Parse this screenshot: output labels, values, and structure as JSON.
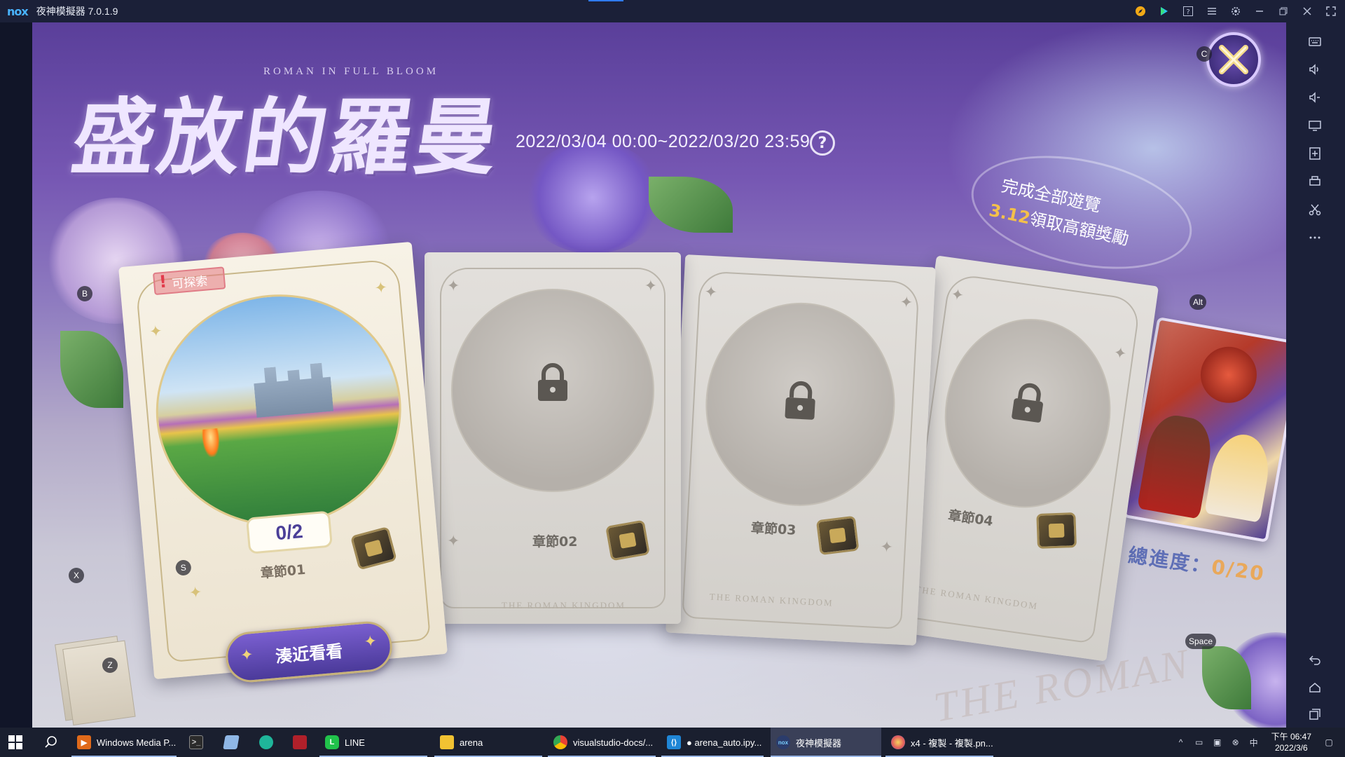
{
  "window": {
    "logo": "nox",
    "title": "夜神模擬器 7.0.1.9",
    "titlebar_icons": [
      "compass-icon",
      "play-store-icon",
      "help-icon",
      "menu-icon",
      "settings-icon",
      "minimize-icon",
      "restore-icon",
      "close-icon",
      "fullscreen-icon"
    ]
  },
  "sidebar": {
    "buttons": [
      "keyboard-icon",
      "volume-up-icon",
      "volume-down-icon",
      "screen-icon",
      "add-apk-icon",
      "printer-icon",
      "scissors-icon",
      "more-icon",
      "back-icon",
      "home-icon",
      "recent-apps-icon"
    ]
  },
  "game": {
    "event_title": "盛放的羅曼",
    "event_subtitle": "ROMAN IN FULL BLOOM",
    "date_range": "2022/03/04 00:00~2022/03/20 23:59",
    "help_symbol": "?",
    "reward_line1": "完成全部遊覽",
    "reward_date": "3.12",
    "reward_line2": "領取高額獎勵",
    "explore_badge": "可探索",
    "explore_mark": "!",
    "cards": [
      {
        "chapter": "章節01",
        "progress": "0/2",
        "kingdom": "",
        "locked": false
      },
      {
        "chapter": "章節02",
        "kingdom": "THE ROMAN KINGDOM",
        "locked": true
      },
      {
        "chapter": "章節03",
        "kingdom": "THE ROMAN KINGDOM",
        "locked": true
      },
      {
        "chapter": "章節04",
        "kingdom": "THE ROMAN KINGDOM",
        "locked": true
      }
    ],
    "approach_button": "湊近看看",
    "total_label": "總進度：",
    "total_value": "0/20",
    "watermark": "THE ROMAN KIN",
    "key_hints": {
      "close": "C",
      "card": "B",
      "approach": "X",
      "progress": "S",
      "letters": "Z",
      "hero": "Alt",
      "space": "Space"
    },
    "colors": {
      "purple": "#5a3f9a",
      "gold": "#c8b78a",
      "accent": "#e9a85a"
    }
  },
  "taskbar": {
    "apps": [
      {
        "label": "Windows Media P...",
        "icon": "media-player-icon"
      },
      {
        "label": "",
        "icon": "terminal-icon"
      },
      {
        "label": "",
        "icon": "notepad-icon"
      },
      {
        "label": "",
        "icon": "globe-icon"
      },
      {
        "label": "",
        "icon": "game-icon"
      },
      {
        "label": "LINE",
        "icon": "line-icon"
      },
      {
        "label": "arena",
        "icon": "folder-icon"
      },
      {
        "label": "visualstudio-docs/...",
        "icon": "chrome-icon"
      },
      {
        "label": "● arena_auto.ipy...",
        "icon": "vscode-icon"
      },
      {
        "label": "夜神模擬器",
        "icon": "nox-icon"
      },
      {
        "label": "x4 - 複製 - 複製.pn...",
        "icon": "paint-icon"
      }
    ],
    "clock_time": "下午 06:47",
    "clock_date": "2022/3/6"
  }
}
